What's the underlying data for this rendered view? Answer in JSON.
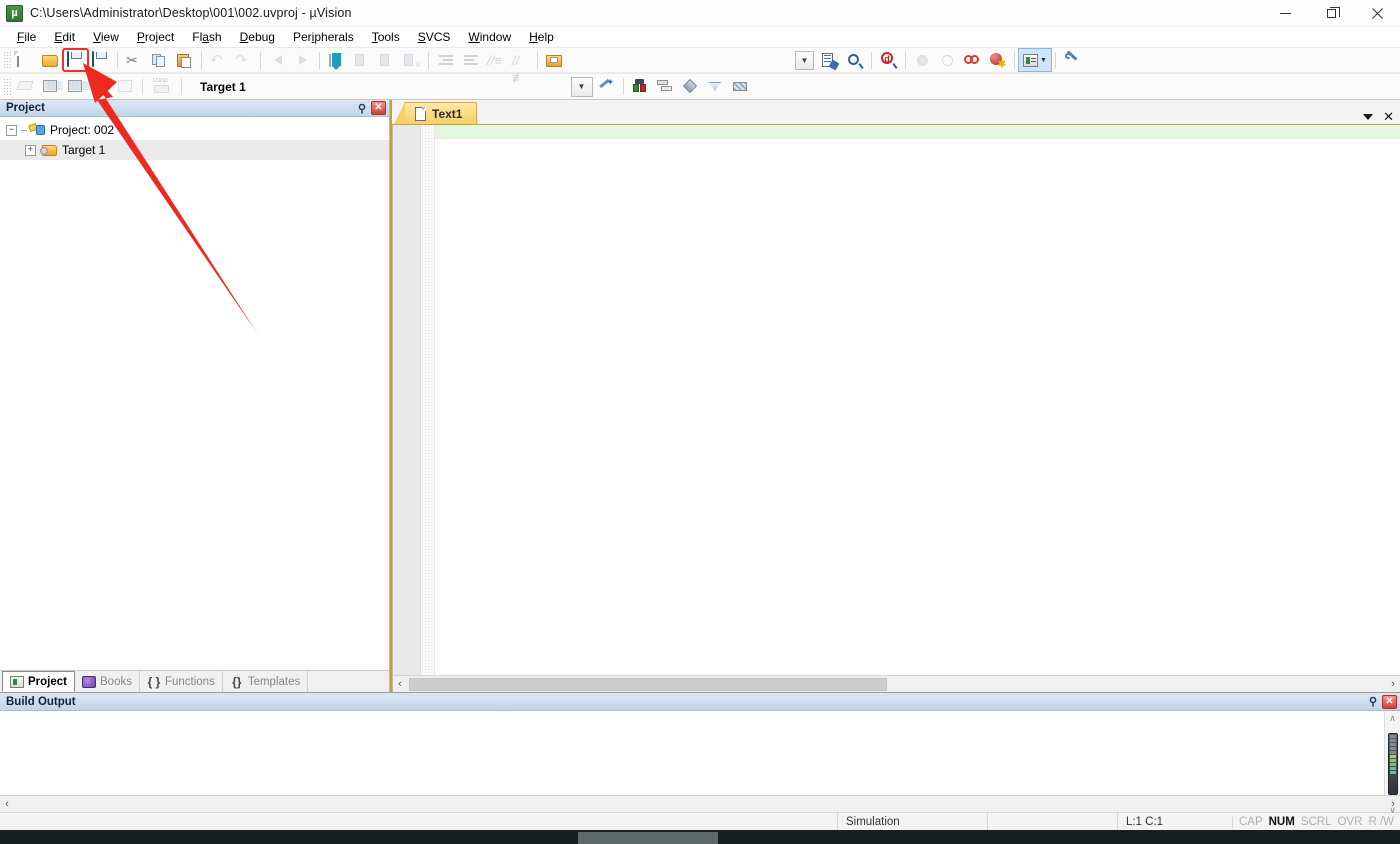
{
  "window": {
    "title": "C:\\Users\\Administrator\\Desktop\\001\\002.uvproj - µVision",
    "logo_icon": "uvision-logo-icon",
    "minimize_label": "–",
    "maximize_label": "❐",
    "close_label": "✕"
  },
  "menubar": {
    "items": [
      {
        "label": "File",
        "accel": "F"
      },
      {
        "label": "Edit",
        "accel": "E"
      },
      {
        "label": "View",
        "accel": "V"
      },
      {
        "label": "Project",
        "accel": "P"
      },
      {
        "label": "Flash",
        "accel": "a"
      },
      {
        "label": "Debug",
        "accel": "D"
      },
      {
        "label": "Peripherals",
        "accel": "i"
      },
      {
        "label": "Tools",
        "accel": "T"
      },
      {
        "label": "SVCS",
        "accel": "S"
      },
      {
        "label": "Window",
        "accel": "W"
      },
      {
        "label": "Help",
        "accel": "H"
      }
    ]
  },
  "toolbar_main": {
    "buttons": [
      {
        "name": "new-file-icon",
        "tooltip": "New",
        "enabled": true,
        "highlighted": false
      },
      {
        "name": "open-file-icon",
        "tooltip": "Open",
        "enabled": true,
        "highlighted": false
      },
      {
        "name": "save-icon",
        "tooltip": "Save",
        "enabled": true,
        "highlighted": true
      },
      {
        "name": "save-all-icon",
        "tooltip": "Save All",
        "enabled": true,
        "highlighted": false
      },
      {
        "name": "cut-icon",
        "tooltip": "Cut",
        "enabled": true,
        "highlighted": false
      },
      {
        "name": "copy-icon",
        "tooltip": "Copy",
        "enabled": true,
        "highlighted": false
      },
      {
        "name": "paste-icon",
        "tooltip": "Paste",
        "enabled": true,
        "highlighted": false
      },
      {
        "name": "undo-icon",
        "tooltip": "Undo",
        "enabled": false,
        "highlighted": false
      },
      {
        "name": "redo-icon",
        "tooltip": "Redo",
        "enabled": false,
        "highlighted": false
      },
      {
        "name": "navigate-back-icon",
        "tooltip": "Back",
        "enabled": false,
        "highlighted": false
      },
      {
        "name": "navigate-forward-icon",
        "tooltip": "Forward",
        "enabled": false,
        "highlighted": false
      },
      {
        "name": "bookmark-toggle-icon",
        "tooltip": "Insert/Remove Bookmark",
        "enabled": true,
        "highlighted": false
      },
      {
        "name": "bookmark-prev-icon",
        "tooltip": "Previous Bookmark",
        "enabled": false,
        "highlighted": false
      },
      {
        "name": "bookmark-next-icon",
        "tooltip": "Next Bookmark",
        "enabled": false,
        "highlighted": false
      },
      {
        "name": "bookmark-clear-icon",
        "tooltip": "Clear Bookmarks",
        "enabled": false,
        "highlighted": false
      },
      {
        "name": "indent-right-icon",
        "tooltip": "Indent",
        "enabled": false,
        "highlighted": false
      },
      {
        "name": "indent-left-icon",
        "tooltip": "Unindent",
        "enabled": false,
        "highlighted": false
      },
      {
        "name": "comment-icon",
        "tooltip": "Comment",
        "enabled": false,
        "highlighted": false
      },
      {
        "name": "uncomment-icon",
        "tooltip": "Uncomment",
        "enabled": false,
        "highlighted": false
      },
      {
        "name": "open-folder-icon",
        "tooltip": "Open Folder",
        "enabled": true,
        "highlighted": false
      }
    ],
    "right_buttons": [
      {
        "name": "dropdown-arrow-icon",
        "tooltip": "Select",
        "enabled": true,
        "highlighted": false
      },
      {
        "name": "source-browse-icon",
        "tooltip": "Source Browser",
        "enabled": true,
        "highlighted": false
      },
      {
        "name": "find-in-files-icon",
        "tooltip": "Find in Files",
        "enabled": true,
        "highlighted": false
      },
      {
        "name": "debug-query-icon",
        "tooltip": "Configuration Wizard",
        "enabled": true,
        "highlighted": false
      },
      {
        "name": "breakpoint-filled-icon",
        "tooltip": "Insert Breakpoint",
        "enabled": false,
        "highlighted": false
      },
      {
        "name": "breakpoint-empty-icon",
        "tooltip": "Enable Breakpoint",
        "enabled": false,
        "highlighted": false
      },
      {
        "name": "breakpoint-disable-icon",
        "tooltip": "Disable All Breakpoints",
        "enabled": true,
        "highlighted": false
      },
      {
        "name": "breakpoint-kill-icon",
        "tooltip": "Kill All Breakpoints",
        "enabled": true,
        "highlighted": false
      },
      {
        "name": "project-window-icon",
        "tooltip": "Project Window",
        "enabled": true,
        "highlighted": false,
        "active": true
      },
      {
        "name": "options-wrench-icon",
        "tooltip": "Configure",
        "enabled": true,
        "highlighted": false
      }
    ]
  },
  "toolbar_build": {
    "buttons": [
      {
        "name": "translate-icon",
        "tooltip": "Translate File",
        "enabled": false
      },
      {
        "name": "build-target-icon",
        "tooltip": "Build Target",
        "enabled": true
      },
      {
        "name": "rebuild-all-icon",
        "tooltip": "Rebuild All",
        "enabled": true
      },
      {
        "name": "batch-build-icon",
        "tooltip": "Batch Build",
        "enabled": false
      },
      {
        "name": "stop-build-icon",
        "tooltip": "Stop Build",
        "enabled": false
      },
      {
        "name": "download-load-icon",
        "tooltip": "Download",
        "enabled": false
      }
    ],
    "target_label": "Target 1",
    "target_dropdown_icon": "chevron-down-icon",
    "right_buttons": [
      {
        "name": "target-options-icon",
        "tooltip": "Options for Target",
        "enabled": true
      },
      {
        "name": "manage-runtime-icon",
        "tooltip": "Manage Run-Time Env",
        "enabled": true
      },
      {
        "name": "manage-project-icon",
        "tooltip": "Manage Project Items",
        "enabled": true
      },
      {
        "name": "components-icon",
        "tooltip": "Components",
        "enabled": true
      },
      {
        "name": "multi-project-icon",
        "tooltip": "Multi-Project",
        "enabled": true
      },
      {
        "name": "packs-icon",
        "tooltip": "Pack Installer",
        "enabled": true
      }
    ]
  },
  "project_pane": {
    "title": "Project",
    "pin_icon": "pin-icon",
    "close_icon": "close-icon",
    "tree": [
      {
        "label": "Project: 002",
        "icon": "project-icon",
        "expander": "−",
        "level": 0,
        "selected": false
      },
      {
        "label": "Target 1",
        "icon": "target-icon",
        "expander": "+",
        "level": 1,
        "selected": true
      }
    ],
    "tabs": [
      {
        "label": "Project",
        "icon": "project-tab-icon",
        "active": true
      },
      {
        "label": "Books",
        "icon": "books-tab-icon",
        "active": false
      },
      {
        "label": "Functions",
        "icon": "functions-tab-icon",
        "active": false,
        "glyph": "{ }"
      },
      {
        "label": "Templates",
        "icon": "templates-tab-icon",
        "active": false,
        "glyph": "{}"
      }
    ]
  },
  "editor": {
    "tab_label": "Text1",
    "tab_icon": "document-icon",
    "tab_dropdown_icon": "chevron-down-icon",
    "tab_close_icon": "close-icon",
    "content": "",
    "scroll_left_icon": "chevron-left-icon",
    "scroll_right_icon": "chevron-right-icon"
  },
  "build_output": {
    "title": "Build Output",
    "pin_icon": "pin-icon",
    "close_icon": "close-icon",
    "content": "",
    "scroll_up_icon": "chevron-up-icon",
    "scroll_down_icon": "chevron-down-icon",
    "scroll_left_icon": "chevron-left-icon",
    "scroll_right_icon": "chevron-right-icon"
  },
  "statusbar": {
    "message": "",
    "simulation": "Simulation",
    "blank": "",
    "position": "L:1 C:1",
    "flags": [
      {
        "label": "CAP",
        "on": false
      },
      {
        "label": "NUM",
        "on": true
      },
      {
        "label": "SCRL",
        "on": false
      },
      {
        "label": "OVR",
        "on": false
      },
      {
        "label": "R /W",
        "on": false
      }
    ]
  },
  "annotation": {
    "arrow_color": "#ee2a20",
    "highlight_color": "#e8342c",
    "description": "red-arrow-pointing-to-save-button"
  }
}
